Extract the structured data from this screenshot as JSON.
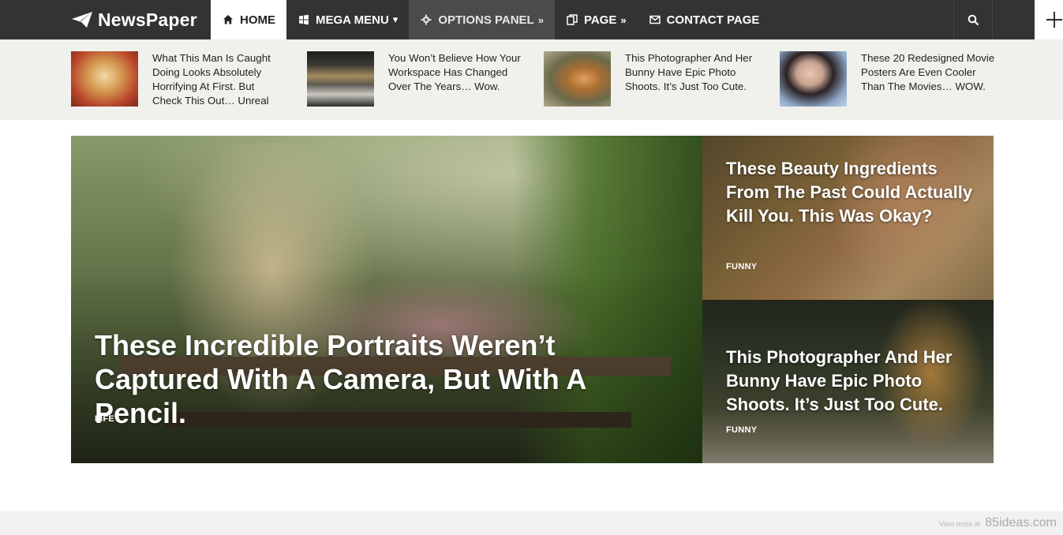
{
  "brand": {
    "name": "NewsPaper"
  },
  "nav": {
    "items": [
      {
        "label": "HOME",
        "icon": "home-icon",
        "arrow": ""
      },
      {
        "label": "MEGA MENU",
        "icon": "windows-icon",
        "arrow": "▾"
      },
      {
        "label": "OPTIONS PANEL",
        "icon": "gear-icon",
        "arrow": "»"
      },
      {
        "label": "PAGE",
        "icon": "copy-icon",
        "arrow": "»"
      },
      {
        "label": "CONTACT PAGE",
        "icon": "envelope-icon",
        "arrow": ""
      }
    ]
  },
  "ticker": [
    {
      "title": "What This Man Is Caught Doing Looks Absolutely Horrifying At First. But Check This Out… Unreal"
    },
    {
      "title": "You Won’t Believe How Your Workspace Has Changed Over The Years… Wow."
    },
    {
      "title": "This Photographer And Her Bunny Have Epic Photo Shoots. It’s Just Too Cute."
    },
    {
      "title": "These 20 Redesigned Movie Posters Are Even Cooler Than The Movies… WOW."
    }
  ],
  "featured": {
    "main": {
      "title": "These Incredible Portraits Weren’t Captured With A Camera, But With A Pencil.",
      "category": "LIFE"
    },
    "side_top": {
      "title": "These Beauty Ingredients From The Past Could Actually Kill You. This Was Okay?",
      "category": "FUNNY"
    },
    "side_bottom": {
      "title": "This Photographer And Her Bunny Have Epic Photo Shoots. It’s Just Too Cute.",
      "category": "FUNNY"
    }
  },
  "watermark": {
    "prefix": "View more at",
    "site": "85ideas.com"
  },
  "colors": {
    "nav_bg": "#333333",
    "ticker_bg": "#f0f1ed",
    "active_bg": "#ffffff"
  }
}
